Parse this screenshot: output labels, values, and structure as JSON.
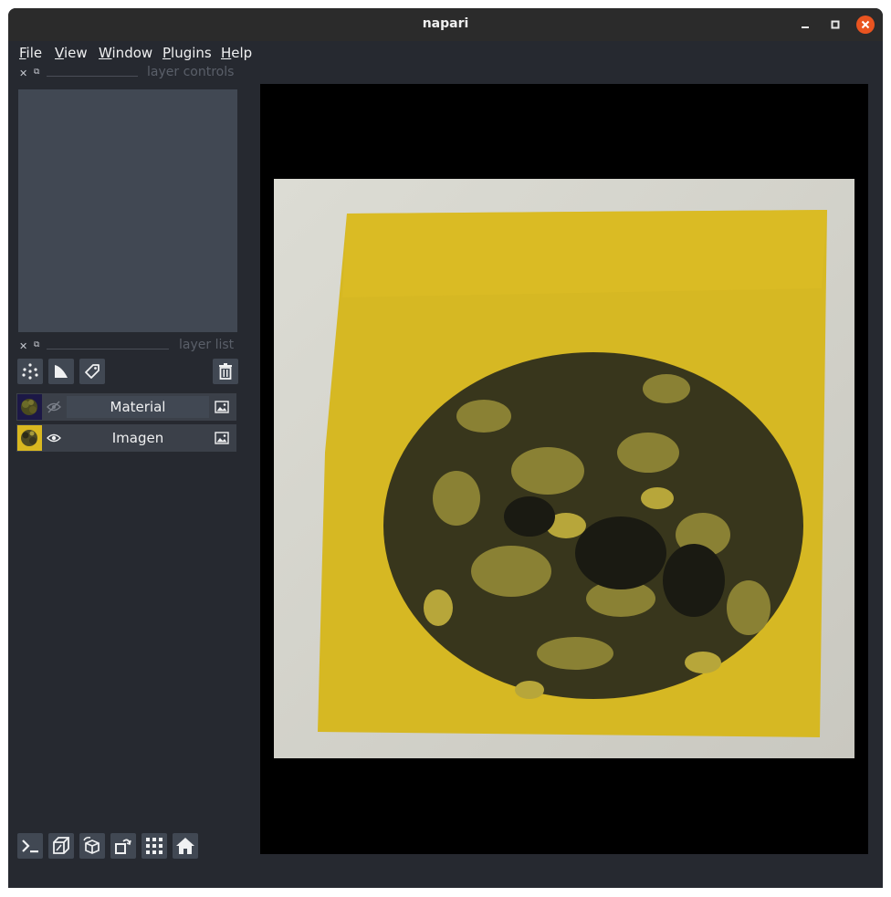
{
  "window": {
    "title": "napari",
    "minimize_icon": "minimize-icon",
    "maximize_icon": "maximize-icon",
    "close_icon": "close-icon",
    "close_color": "#e95420"
  },
  "menubar": {
    "items": [
      {
        "first": "F",
        "rest": "ile"
      },
      {
        "first": "V",
        "rest": "iew"
      },
      {
        "first": "W",
        "rest": "indow"
      },
      {
        "first": "P",
        "rest": "lugins"
      },
      {
        "first": "H",
        "rest": "elp"
      }
    ]
  },
  "layer_controls": {
    "title": "layer controls"
  },
  "layer_list": {
    "title": "layer list",
    "toolbar_icons": [
      "new-points-layer-icon",
      "new-shapes-layer-icon",
      "new-labels-layer-icon",
      "delete-layer-icon"
    ],
    "layers": [
      {
        "name": "Material",
        "visible": false,
        "selected": true,
        "type_icon": "image-layer-icon"
      },
      {
        "name": "Imagen",
        "visible": true,
        "selected": false,
        "type_icon": "image-layer-icon"
      }
    ]
  },
  "viewer_buttons": [
    "console-icon",
    "ndisplay-icon",
    "roll-dims-icon",
    "transpose-dims-icon",
    "grid-mode-icon",
    "home-icon"
  ],
  "colors": {
    "background": "#262930",
    "panel": "#414853",
    "foreground": "#f0f1f2",
    "canvas": "#000000",
    "sample_yellow": "#d9b820"
  }
}
